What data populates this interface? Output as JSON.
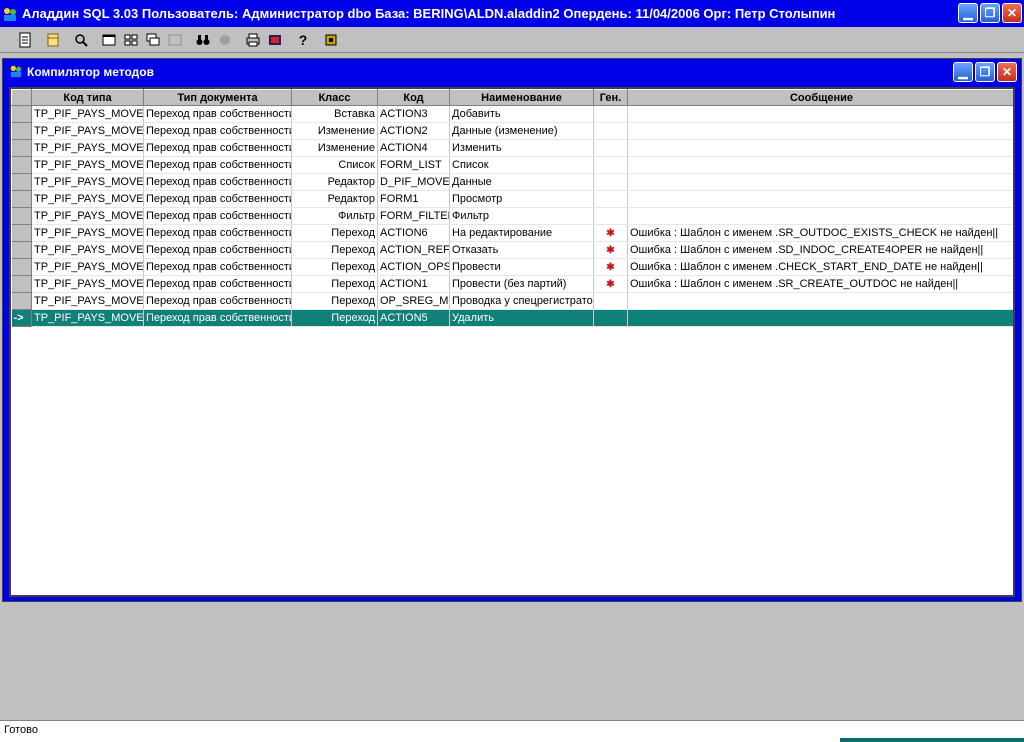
{
  "app": {
    "title": "Аладдин SQL 3.03 Пользователь: Администратор dbo База: BERING\\ALDN.aladdin2 Опердень: 11/04/2006 Орг: Петр Столыпин"
  },
  "toolbar": {
    "items": [
      "document-icon",
      "database-icon",
      "search-tool-icon",
      "window-icon",
      "tile-icon",
      "cascade-icon",
      "window-disabled-icon",
      "binoculars-icon",
      "stop-icon",
      "print-icon",
      "film-icon",
      "help-icon",
      "exit-icon"
    ]
  },
  "child": {
    "title": "Компилятор методов"
  },
  "grid": {
    "columns": [
      "Код типа",
      "Тип документа",
      "Класс",
      "Код",
      "Наименование",
      "Ген.",
      "Сообщение"
    ],
    "rows": [
      {
        "type_code": "TP_PIF_PAYS_MOVES",
        "doc_type": "Переход прав собственности",
        "cls": "Вставка",
        "code": "ACTION3",
        "name": "Добавить",
        "gen": "",
        "msg": ""
      },
      {
        "type_code": "TP_PIF_PAYS_MOVES",
        "doc_type": "Переход прав собственности",
        "cls": "Изменение",
        "code": "ACTION2",
        "name": "Данные (изменение)",
        "gen": "",
        "msg": ""
      },
      {
        "type_code": "TP_PIF_PAYS_MOVES",
        "doc_type": "Переход прав собственности",
        "cls": "Изменение",
        "code": "ACTION4",
        "name": "Изменить",
        "gen": "",
        "msg": ""
      },
      {
        "type_code": "TP_PIF_PAYS_MOVES",
        "doc_type": "Переход прав собственности",
        "cls": "Список",
        "code": "FORM_LIST",
        "name": "Список",
        "gen": "",
        "msg": ""
      },
      {
        "type_code": "TP_PIF_PAYS_MOVES",
        "doc_type": "Переход прав собственности",
        "cls": "Редактор",
        "code": "D_PIF_MOVES",
        "name": "Данные",
        "gen": "",
        "msg": ""
      },
      {
        "type_code": "TP_PIF_PAYS_MOVES",
        "doc_type": "Переход прав собственности",
        "cls": "Редактор",
        "code": "FORM1",
        "name": "Просмотр",
        "gen": "",
        "msg": ""
      },
      {
        "type_code": "TP_PIF_PAYS_MOVES",
        "doc_type": "Переход прав собственности",
        "cls": "Фильтр",
        "code": "FORM_FILTER",
        "name": "Фильтр",
        "gen": "",
        "msg": ""
      },
      {
        "type_code": "TP_PIF_PAYS_MOVES",
        "doc_type": "Переход прав собственности",
        "cls": "Переход",
        "code": "ACTION6",
        "name": "На редактирование",
        "gen": "✱",
        "msg": "Ошибка : Шаблон с именем .SR_OUTDOC_EXISTS_CHECK не найден||"
      },
      {
        "type_code": "TP_PIF_PAYS_MOVES",
        "doc_type": "Переход прав собственности",
        "cls": "Переход",
        "code": "ACTION_REFU",
        "name": "Отказать",
        "gen": "✱",
        "msg": "Ошибка : Шаблон с именем .SD_INDOC_CREATE4OPER не найден||"
      },
      {
        "type_code": "TP_PIF_PAYS_MOVES",
        "doc_type": "Переход прав собственности",
        "cls": "Переход",
        "code": "ACTION_OPS",
        "name": "Провести",
        "gen": "✱",
        "msg": "Ошибка : Шаблон с именем .CHECK_START_END_DATE не найден||"
      },
      {
        "type_code": "TP_PIF_PAYS_MOVES",
        "doc_type": "Переход прав собственности",
        "cls": "Переход",
        "code": "ACTION1",
        "name": "Провести (без партий)",
        "gen": "✱",
        "msg": "Ошибка : Шаблон с именем .SR_CREATE_OUTDOC не найден||"
      },
      {
        "type_code": "TP_PIF_PAYS_MOVES",
        "doc_type": "Переход прав собственности",
        "cls": "Переход",
        "code": "OP_SREG_MC",
        "name": "Проводка у спецрегистратора",
        "gen": "",
        "msg": ""
      },
      {
        "type_code": "TP_PIF_PAYS_MOVES",
        "doc_type": "Переход прав собственности",
        "cls": "Переход",
        "code": "ACTION5",
        "name": "Удалить",
        "gen": "",
        "msg": "",
        "selected": true,
        "indicator": "->"
      }
    ]
  },
  "status": {
    "text": "Готово"
  }
}
